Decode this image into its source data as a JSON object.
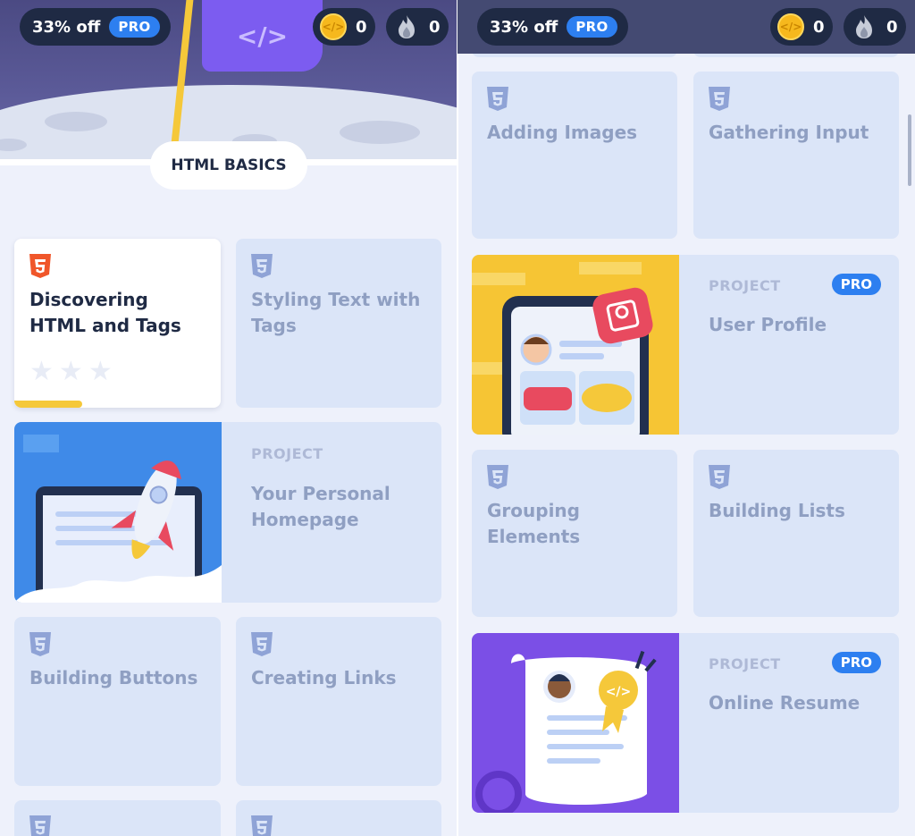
{
  "topbar": {
    "promo_text": "33% off",
    "promo_badge": "PRO",
    "coins_count": "0",
    "streak_count": "0"
  },
  "left_panel": {
    "section_title": "HTML BASICS",
    "lessons": [
      {
        "title": "Discovering HTML and Tags",
        "stars_earned": 0,
        "stars_total": 3,
        "progress": 0.33
      },
      {
        "title": "Styling Text with Tags"
      },
      {
        "title": "Building Buttons"
      },
      {
        "title": "Creating Links"
      }
    ],
    "project": {
      "kicker": "PROJECT",
      "title": "Your Personal Homepage"
    }
  },
  "right_panel": {
    "lessons": [
      {
        "title": "Adding Images"
      },
      {
        "title": "Gathering Input"
      },
      {
        "title": "Grouping Elements"
      },
      {
        "title": "Building Lists"
      }
    ],
    "projects": [
      {
        "kicker": "PROJECT",
        "badge": "PRO",
        "title": "User Profile"
      },
      {
        "kicker": "PROJECT",
        "badge": "PRO",
        "title": "Online Resume"
      }
    ]
  },
  "colors": {
    "accent_blue": "#2d7ff0",
    "progress_yellow": "#f5c83a",
    "html5_orange": "#f0562a",
    "html5_muted": "#8fa3d6",
    "card_bg": "#dbe5f8",
    "dark_navy": "#1f2a44"
  }
}
